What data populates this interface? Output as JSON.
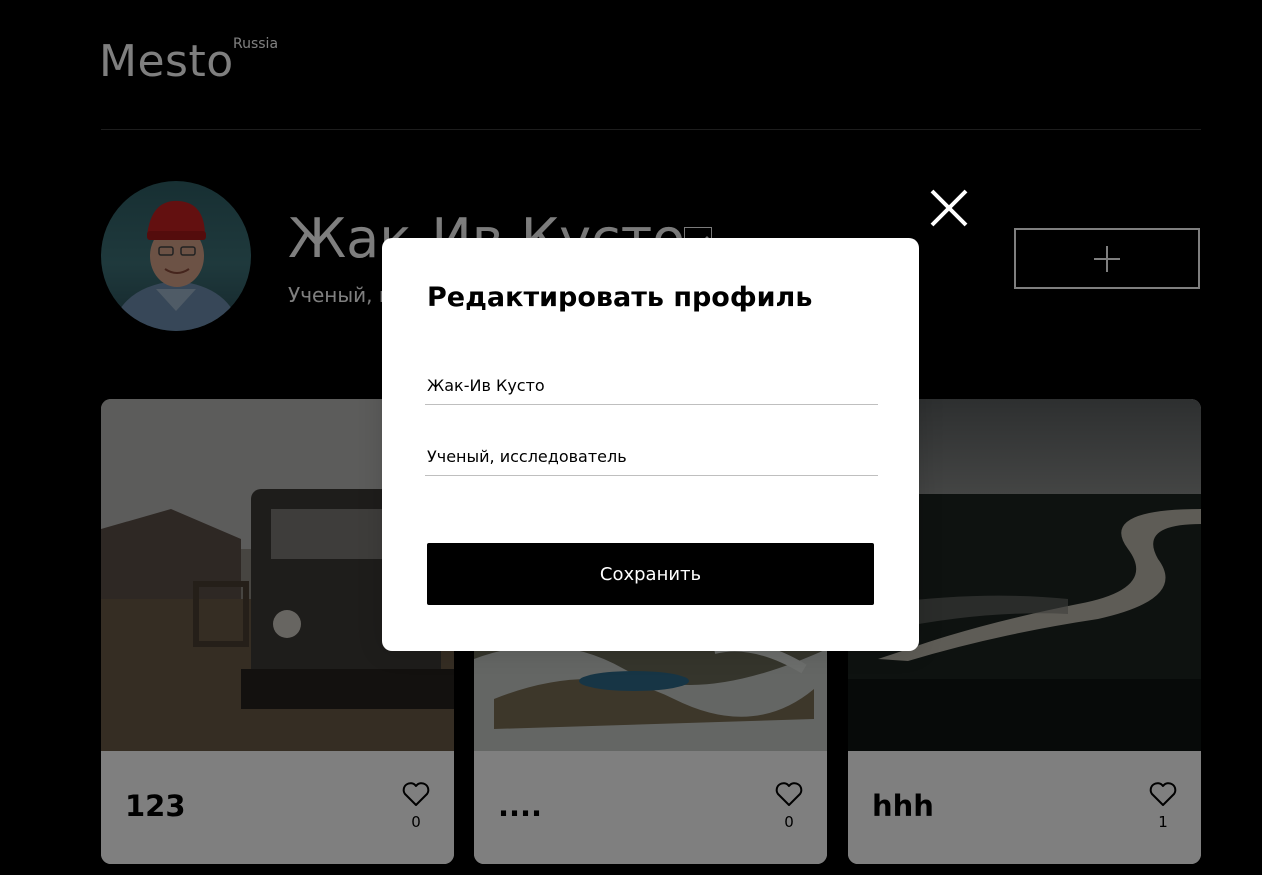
{
  "header": {
    "logo_text": "Mesto",
    "logo_region": "Russia"
  },
  "profile": {
    "name": "Жак-Ив Кусто",
    "about": "Ученый, исследователь",
    "edit_icon": "pencil-icon",
    "add_icon": "plus-icon"
  },
  "cards": [
    {
      "title": "123",
      "likes": "0",
      "like_icon": "heart-icon"
    },
    {
      "title": "....",
      "likes": "0",
      "like_icon": "heart-icon"
    },
    {
      "title": "hhh",
      "likes": "1",
      "like_icon": "heart-icon"
    }
  ],
  "modal": {
    "title": "Редактировать профиль",
    "name_value": "Жак-Ив Кусто",
    "about_value": "Ученый, исследователь",
    "save_label": "Сохранить",
    "close_icon": "close-icon"
  },
  "colors": {
    "background": "#000000",
    "modal_background": "#ffffff",
    "overlay": "rgba(0,0,0,0.5)",
    "button": "#000000"
  }
}
